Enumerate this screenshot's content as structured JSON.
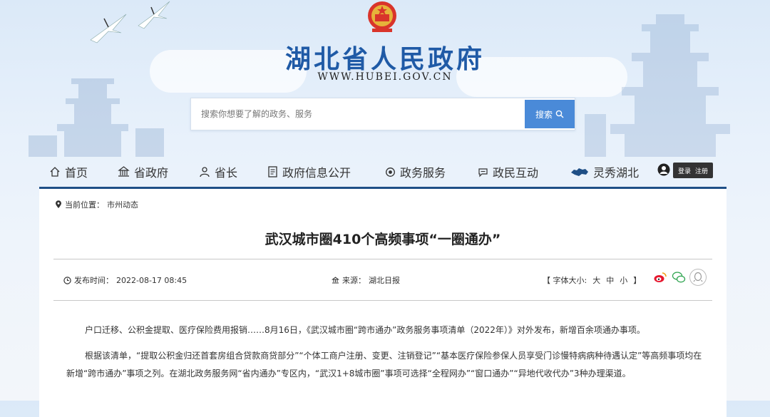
{
  "header": {
    "site_title": "湖北省人民政府",
    "site_url": "WWW.HUBEI.GOV.CN"
  },
  "search": {
    "placeholder": "搜索你想要了解的政务、服务",
    "button_label": "搜索"
  },
  "nav": {
    "items": [
      {
        "label": "首页",
        "icon": "home-icon"
      },
      {
        "label": "省政府",
        "icon": "building-icon"
      },
      {
        "label": "省长",
        "icon": "person-icon"
      },
      {
        "label": "政府信息公开",
        "icon": "document-icon"
      },
      {
        "label": "政务服务",
        "icon": "service-icon"
      },
      {
        "label": "政民互动",
        "icon": "chat-icon"
      },
      {
        "label": "灵秀湖北",
        "icon": "hubei-map-icon"
      }
    ],
    "login_label": "登录",
    "register_label": "注册"
  },
  "breadcrumb": {
    "prefix": "当前位置：",
    "current": "市州动态"
  },
  "article": {
    "title": "武汉城市圈410个高频事项“一圈通办”",
    "publish_label": "发布时间：",
    "publish_time": "2022-08-17 08:45",
    "source_label": "来源：",
    "source": "湖北日报",
    "font_size_open": "【 字体大小:",
    "font_size_large": "大",
    "font_size_medium": "中",
    "font_size_small": "小",
    "font_size_close": "】",
    "paragraphs": [
      "户口迁移、公积金提取、医疗保险费用报销……8月16日，《武汉城市圈“跨市通办”政务服务事项清单（2022年）》对外发布，新增百余项通办事项。",
      "根据该清单，“提取公积金归还首套房组合贷款商贷部分”“个体工商户注册、变更、注销登记”“基本医疗保险参保人员享受门诊慢特病病种待遇认定”等高频事项均在新增“跨市通办”事项之列。在湖北政务服务网“省内通办”专区内，“武汉1+8城市圈”事项可选择“全程网办”“窗口通办”“异地代收代办”3种办理渠道。"
    ]
  },
  "share": {
    "icons": [
      "weibo-icon",
      "wechat-icon",
      "qq-icon"
    ]
  },
  "colors": {
    "brand_blue": "#1f5aa6",
    "panel_border": "#1f4f86",
    "search_button": "#4a8ad8"
  }
}
